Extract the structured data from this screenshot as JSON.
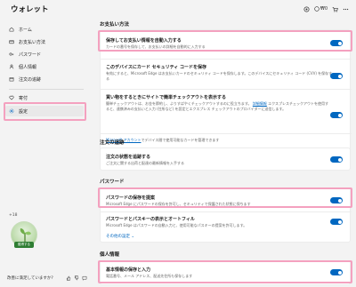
{
  "header": {
    "title": "ウォレット",
    "coins": "₩0",
    "icons": [
      "mission-icon",
      "coin-icon",
      "cart-icon",
      "more-icon"
    ]
  },
  "sidebar": {
    "items": [
      {
        "label": "ホーム",
        "icon": "home-icon"
      },
      {
        "label": "お支払い方法",
        "icon": "card-icon"
      },
      {
        "label": "パスワード",
        "icon": "key-icon"
      },
      {
        "label": "個人情報",
        "icon": "person-icon"
      },
      {
        "label": "注文の追跡",
        "icon": "box-icon"
      },
      {
        "label": "寄付",
        "icon": "heart-icon"
      },
      {
        "label": "設定",
        "icon": "gear-icon"
      }
    ],
    "badge_count": "+18",
    "avatar_label": "獲得する",
    "footer_text": "改善に満足していますか?"
  },
  "sections": {
    "payment": {
      "title": "お支払い方法",
      "rows": [
        {
          "title": "保存してお支払い情報を自動入力する",
          "desc": "カードの番号を保存して、お支払いの詳細を自動的に入力する"
        },
        {
          "title": "このデバイスにカード セキュリティ コードを保存",
          "desc": "有効にすると、Microsoft Edge はお支払いカードのセキュリティ コードを保存します。このデバイスにセキュリティ コード (CVV) を保存する"
        },
        {
          "title": "買い物をするときにサイトで簡単チェックアウトを表示する",
          "desc": "簡単チェックアウトは、お金を節約し、よりすばやくチェックアウトするのに役立ちます。",
          "link": "詳細情報",
          "desc2": "エクスプレスチェックアウトを使用すると、連携済みの支払いと入力 (住所など) を設定とエクスプレス チェックアウトのプロバイダーに送信します。"
        }
      ],
      "account_link": "Microsoft アカウント",
      "account_text": "でデバイス間で使用可能なカードを管理できます"
    },
    "tracking": {
      "title": "注文の追跡",
      "rows": [
        {
          "title": "注文の状態を追跡する",
          "desc": "ご注文に関する出荷と配達の最新情報を入手する"
        }
      ]
    },
    "password": {
      "title": "パスワード",
      "rows": [
        {
          "title": "パスワードの保存を提案",
          "desc": "Microsoft Edge にパスワードの保存を許可し、セキュリティで保護された状態に保ちます"
        },
        {
          "title": "パスワードとパスキーの表示とオートフィル",
          "desc": "Microsoft Edge はパスワードの自動入力と、使用可能なパスキーの提案を許可します。"
        }
      ],
      "more": "その他の設定 ⌄"
    },
    "personal": {
      "title": "個人情報",
      "rows": [
        {
          "title": "基本情報の保存と入力",
          "desc": "電話番号、メール アドレス、配送先住所も保存します"
        }
      ]
    }
  },
  "colors": {
    "accent": "#0067c0",
    "highlight": "#f4a1bf"
  }
}
